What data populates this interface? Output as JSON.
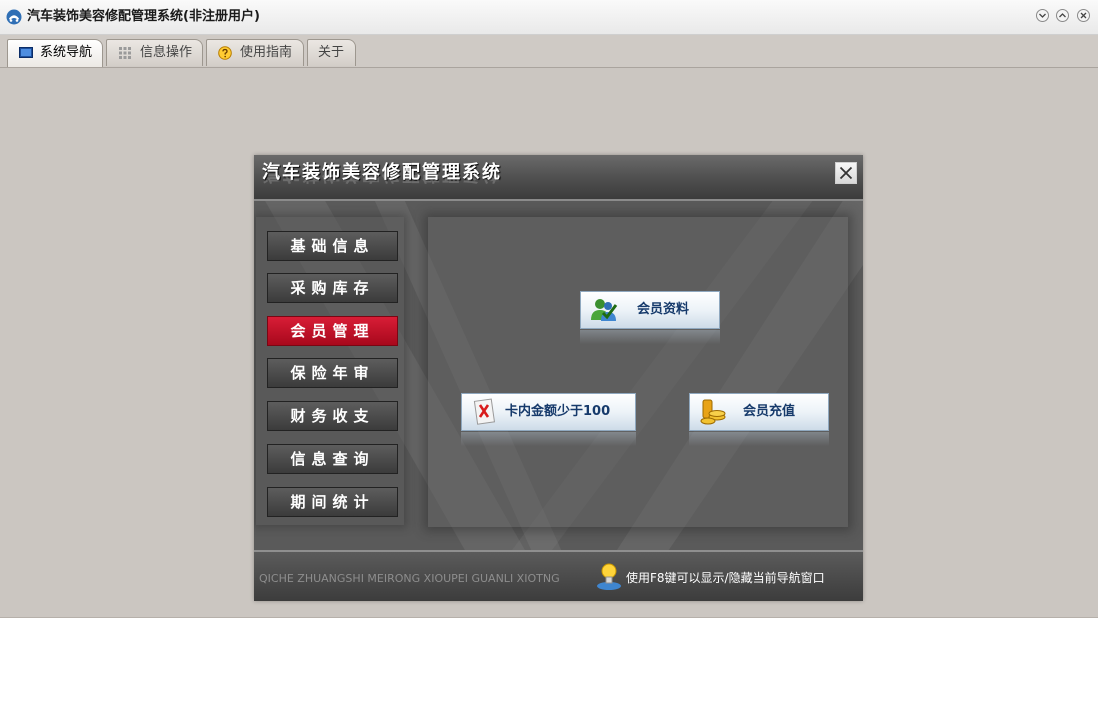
{
  "window": {
    "title": "汽车装饰美容修配管理系统(非注册用户)",
    "icon": "car-logo-icon"
  },
  "tabs": [
    {
      "label": "系统导航",
      "icon": "monitor-icon",
      "active": true
    },
    {
      "label": "信息操作",
      "icon": "grid-icon",
      "active": false
    },
    {
      "label": "使用指南",
      "icon": "help-icon",
      "active": false
    },
    {
      "label": "关于",
      "icon": "",
      "active": false
    }
  ],
  "panel": {
    "title": "汽车装饰美容修配管理系统",
    "close_icon": "close-icon"
  },
  "menu": [
    {
      "label": "基础信息",
      "selected": false
    },
    {
      "label": "采购库存",
      "selected": false
    },
    {
      "label": "会员管理",
      "selected": true
    },
    {
      "label": "保险年审",
      "selected": false
    },
    {
      "label": "财务收支",
      "selected": false
    },
    {
      "label": "信息查询",
      "selected": false
    },
    {
      "label": "期间统计",
      "selected": false
    }
  ],
  "actions": {
    "member_info": {
      "label": "会员资料",
      "icon": "member-profile-icon"
    },
    "low_balance": {
      "label": "卡内金额少于100",
      "icon": "card-warning-icon"
    },
    "recharge": {
      "label": "会员充值",
      "icon": "coins-icon"
    }
  },
  "footer": {
    "pinyin": "QICHE ZHUANGSHI MEIRONG XIOUPEI GUANLI XIOTNG",
    "tip": "使用F8键可以显示/隐藏当前导航窗口",
    "tip_icon": "lightbulb-icon"
  },
  "colors": {
    "selected_menu": "#c8102e",
    "panel_bg": "#5a5a5a",
    "button_text": "#163a6b"
  }
}
